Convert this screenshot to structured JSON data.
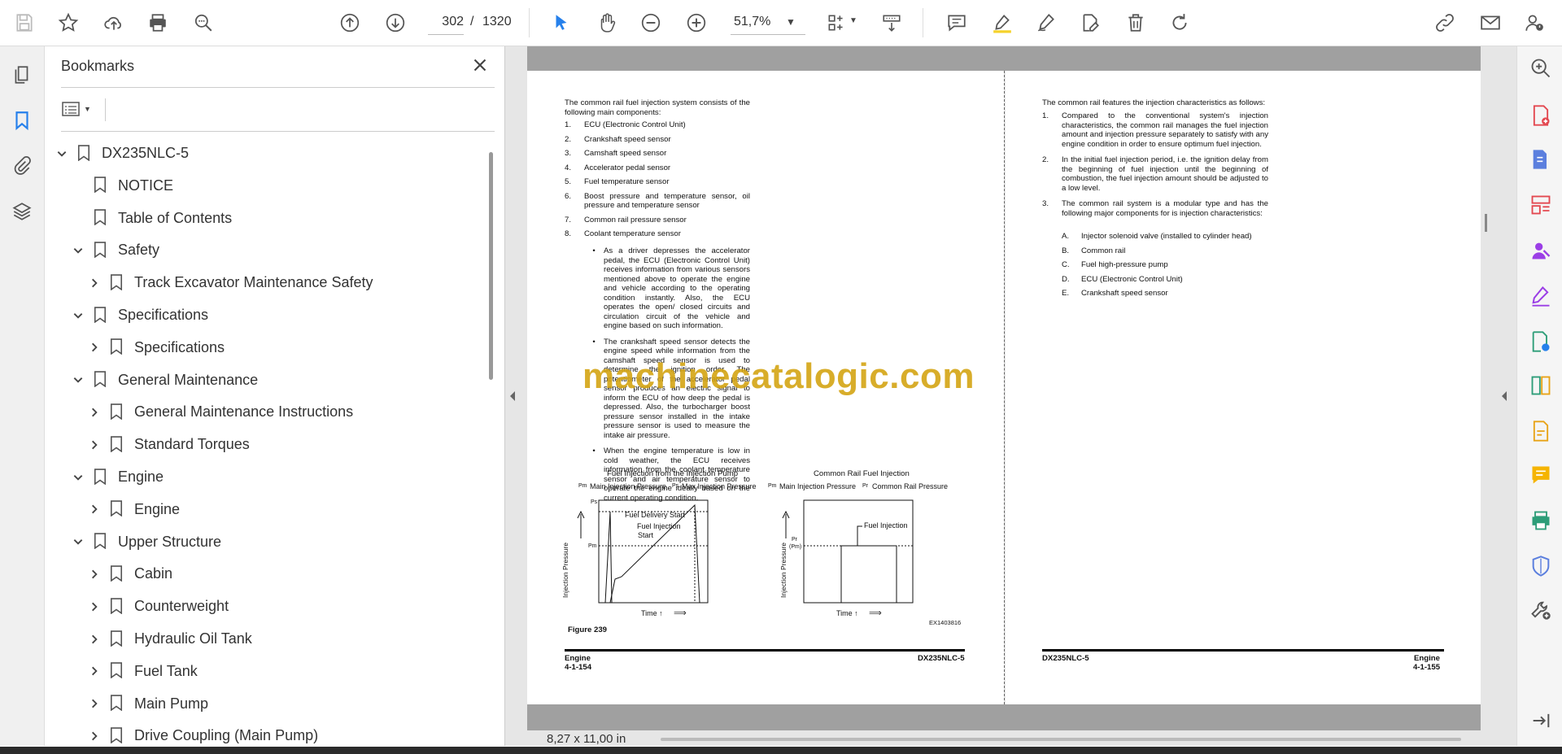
{
  "toolbar": {
    "page_current": "302",
    "page_separator": "/",
    "page_total": "1320",
    "zoom": "51,7%"
  },
  "bookmarks": {
    "title": "Bookmarks",
    "items": [
      {
        "label": "DX235NLC-5",
        "level": 0,
        "expanded": true
      },
      {
        "label": "NOTICE",
        "level": 1,
        "expanded": null
      },
      {
        "label": "Table of Contents",
        "level": 1,
        "expanded": null
      },
      {
        "label": "Safety",
        "level": 1,
        "expanded": true
      },
      {
        "label": "Track Excavator Maintenance Safety",
        "level": 2,
        "expanded": false
      },
      {
        "label": "Specifications",
        "level": 1,
        "expanded": true
      },
      {
        "label": "Specifications",
        "level": 2,
        "expanded": false
      },
      {
        "label": "General Maintenance",
        "level": 1,
        "expanded": true
      },
      {
        "label": "General Maintenance Instructions",
        "level": 2,
        "expanded": false
      },
      {
        "label": "Standard Torques",
        "level": 2,
        "expanded": false
      },
      {
        "label": "Engine",
        "level": 1,
        "expanded": true
      },
      {
        "label": "Engine",
        "level": 2,
        "expanded": false
      },
      {
        "label": "Upper Structure",
        "level": 1,
        "expanded": true
      },
      {
        "label": "Cabin",
        "level": 2,
        "expanded": false
      },
      {
        "label": "Counterweight",
        "level": 2,
        "expanded": false
      },
      {
        "label": "Hydraulic Oil Tank",
        "level": 2,
        "expanded": false
      },
      {
        "label": "Fuel Tank",
        "level": 2,
        "expanded": false
      },
      {
        "label": "Main Pump",
        "level": 2,
        "expanded": false
      },
      {
        "label": "Drive Coupling (Main Pump)",
        "level": 2,
        "expanded": false
      }
    ]
  },
  "document": {
    "left": {
      "intro": "The common rail fuel injection system consists of the following main components:",
      "components": [
        "ECU (Electronic Control Unit)",
        "Crankshaft speed sensor",
        "Camshaft speed sensor",
        "Accelerator pedal sensor",
        "Fuel temperature sensor",
        "Boost pressure and temperature sensor, oil pressure and temperature sensor",
        "Common rail pressure sensor",
        "Coolant temperature sensor"
      ],
      "bullets": [
        "As a driver depresses the accelerator pedal, the ECU (Electronic Control Unit) receives information from various sensors mentioned above to operate the engine and vehicle according to the operating condition instantly. Also, the ECU operates the open/ closed circuits and circulation circuit of the vehicle and engine based on such information.",
        "The crankshaft speed sensor detects the engine speed while information from the camshaft speed sensor is used to determine the ignition order. The potentiometer of the accelerator pedal sensor produces an electric signal to inform the ECU of how deep the pedal is depressed. Also, the turbocharger boost pressure sensor installed in the intake pressure sensor is used to measure the intake air pressure.",
        "When the engine temperature is low in cold weather, the ECU receives information from the coolant temperature sensor and air temperature sensor to operate the engine ideally based on the current operating condition."
      ],
      "figure": {
        "left_title": "Fuel Injection from the Injection Pump",
        "left_legend_pm": "Pm",
        "left_legend_main": "Main Injection Pressure",
        "left_legend_ps": "Ps",
        "left_legend_max": "Max Injection Pressure",
        "left_label_delivery": "Fuel Delivery Start",
        "left_label_injection": "Fuel Injection",
        "left_label_start": "Start",
        "left_y_label": "Injection Pressure",
        "left_ps": "Ps",
        "left_pm": "Pm",
        "left_x_label": "Time ↑",
        "right_title": "Common Rail Fuel Injection",
        "right_legend_pm": "Pm",
        "right_legend_main": "Main Injection Pressure",
        "right_legend_pr": "Pr",
        "right_legend_rail": "Common Rail Pressure",
        "right_label_injection": "Fuel Injection",
        "right_y_label": "Injection Pressure",
        "right_pr": "Pr",
        "right_pm": "(Pm)",
        "right_x_label": "Time ↑",
        "code": "EX1403816",
        "caption": "Figure 239"
      },
      "footer_left_1": "Engine",
      "footer_left_2": "4-1-154",
      "footer_right": "DX235NLC-5"
    },
    "right": {
      "intro": "The common rail features the injection characteristics as follows:",
      "items": [
        "Compared to the conventional system's injection characteristics, the common rail manages the fuel injection amount and injection pressure separately to satisfy with any engine condition in order to ensure optimum fuel injection.",
        "In the initial fuel injection period, i.e. the ignition delay from the beginning of fuel injection until the beginning of combustion, the fuel injection amount should be adjusted to a low level.",
        "The common rail system is a modular type and has the following major components for is injection characteristics:"
      ],
      "sub_items": [
        "Injector solenoid valve (installed to cylinder head)",
        "Common rail",
        "Fuel high-pressure pump",
        "ECU (Electronic Control Unit)",
        "Crankshaft speed sensor"
      ],
      "footer_left": "DX235NLC-5",
      "footer_right_1": "Engine",
      "footer_right_2": "4-1-155"
    },
    "watermark": "machinecatalogic.com",
    "page_size": "8,27 x 11,00 in"
  }
}
